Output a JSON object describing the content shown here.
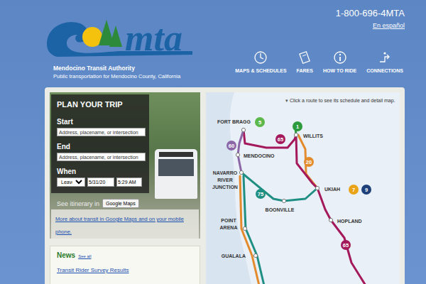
{
  "header": {
    "logo_text": "mta",
    "org_name": "Mendocino Transit Authority",
    "tagline": "Public transportation for Mendocino County, California",
    "phone": "1-800-696-4MTA",
    "language_link": "En español"
  },
  "nav": [
    {
      "label": "MAPS & SCHEDULES"
    },
    {
      "label": "FARES"
    },
    {
      "label": "HOW TO RIDE"
    },
    {
      "label": "CONNECTIONS"
    }
  ],
  "trip_planner": {
    "title": "PLAN YOUR TRIP",
    "start_label": "Start",
    "start_placeholder": "Address, placename, or intersection",
    "end_label": "End",
    "end_placeholder": "Address, placename, or intersection",
    "when_label": "When",
    "when_mode": "Leave at",
    "date": "5/31/20",
    "time": "5:29 AM",
    "itinerary_label": "See itinerary in",
    "itinerary_button": "Google Maps",
    "more_link": "More about transit in Google Maps and on your mobile phone."
  },
  "news": {
    "title": "News",
    "see_all": "See all",
    "items": [
      "Transit Rider Survey Results"
    ]
  },
  "map": {
    "instruction_icon": "▾",
    "instruction": "Click a route to see its schedule and detail map.",
    "places": [
      {
        "name_lines": [
          "FORT BRAGG"
        ]
      },
      {
        "name_lines": [
          "WILLITS"
        ]
      },
      {
        "name_lines": [
          "MENDOCINO"
        ]
      },
      {
        "name_lines": [
          "NAVARRO",
          "RIVER",
          "JUNCTION"
        ]
      },
      {
        "name_lines": [
          "UKIAH"
        ]
      },
      {
        "name_lines": [
          "BOONVILLE"
        ]
      },
      {
        "name_lines": [
          "HOPLAND"
        ]
      },
      {
        "name_lines": [
          "POINT",
          "ARENA"
        ]
      },
      {
        "name_lines": [
          "GUALALA"
        ]
      }
    ],
    "route_badges": [
      {
        "label": "5",
        "color": "#5cb84a"
      },
      {
        "label": "1",
        "color": "#2e9a3e"
      },
      {
        "label": "65",
        "color": "#a3195b"
      },
      {
        "label": "60",
        "color": "#8c67a8"
      },
      {
        "label": "20",
        "color": "#e38b2c"
      },
      {
        "label": "7",
        "color": "#e8a317"
      },
      {
        "label": "9",
        "color": "#1d3f7a"
      },
      {
        "label": "75",
        "color": "#1f8f83"
      },
      {
        "label": "65",
        "color": "#a3195b"
      }
    ]
  }
}
